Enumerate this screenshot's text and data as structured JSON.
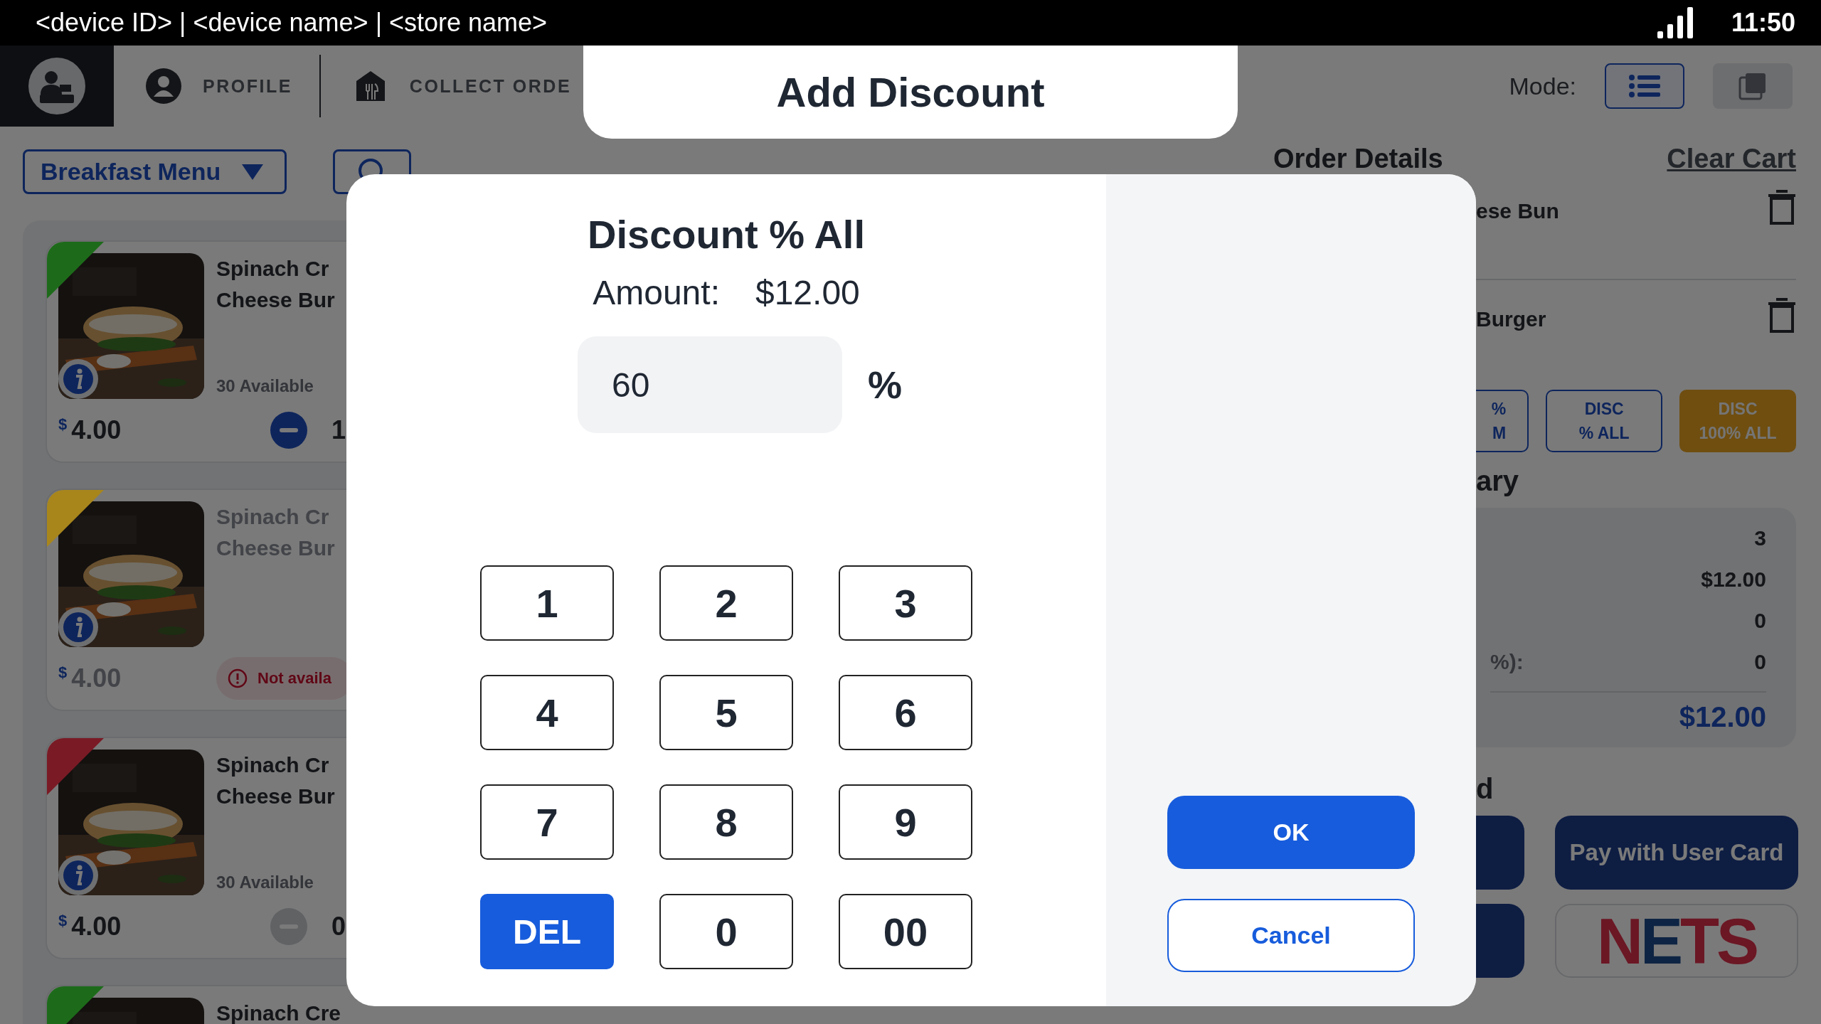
{
  "status_bar": {
    "device_info": "<device ID> | <device name> | <store name>",
    "time": "11:50"
  },
  "nav": {
    "tabs": [
      {
        "kind": "profile",
        "label": "PROFILE",
        "selected": false
      },
      {
        "kind": "store",
        "label": "COLLECT ORDE",
        "selected": false
      }
    ],
    "mode_label": "Mode:",
    "mode_options": [
      {
        "kind": "list",
        "selected": true
      },
      {
        "kind": "window",
        "selected": false
      }
    ]
  },
  "menu": {
    "category": "Breakfast Menu",
    "items": [
      {
        "color": "#1d6b1a",
        "name_lines": [
          "Spinach Cr",
          "Cheese Bur"
        ],
        "availability": "30 Available",
        "currency": "$",
        "price": "4.00",
        "kind": "stepper",
        "stepper_enabled": true,
        "qty": "1"
      },
      {
        "color": "#a8861c",
        "name_lines": [
          "Spinach Cr",
          "Cheese Bur"
        ],
        "currency": "$",
        "price": "4.00",
        "kind": "unavailable",
        "badge": "Not availa"
      },
      {
        "color": "#7a1a25",
        "name_lines": [
          "Spinach Cr",
          "Cheese Bur"
        ],
        "availability": "30 Available",
        "currency": "$",
        "price": "4.00",
        "kind": "stepper",
        "stepper_enabled": false,
        "qty": "0"
      },
      {
        "color": "#1d6b1a",
        "name_lines": [
          "Spinach Cre"
        ],
        "kind": "partial"
      }
    ]
  },
  "order": {
    "title": "Order Details",
    "clear": "Clear Cart",
    "lines": [
      "ese Bun",
      "Burger"
    ],
    "discount_buttons": [
      {
        "lines": [
          "%",
          "M"
        ],
        "selected": false
      },
      {
        "lines": [
          "DISC",
          "% ALL"
        ],
        "selected": false
      },
      {
        "lines": [
          "DISC",
          "100% ALL"
        ],
        "selected": true
      }
    ],
    "summary_heading": "ary",
    "summary_rows": [
      {
        "value": "3"
      },
      {
        "value": "$12.00"
      },
      {
        "value": "0"
      },
      {
        "label": "%):",
        "value": "0"
      }
    ],
    "total": "$12.00",
    "payment_heading": "d",
    "payments": [
      {
        "kind": "button"
      },
      {
        "kind": "button",
        "label": "Pay with User Card"
      },
      {
        "kind": "button"
      },
      {
        "kind": "nets",
        "label": "NETS"
      }
    ]
  },
  "modal": {
    "header": "Add Discount",
    "title": "Discount % All",
    "amount_label": "Amount:",
    "amount": "$12.00",
    "value": "60",
    "unit": "%",
    "keys": [
      {
        "kind": "digit",
        "label": "1"
      },
      {
        "kind": "digit",
        "label": "2"
      },
      {
        "kind": "digit",
        "label": "3"
      },
      {
        "kind": "digit",
        "label": "4"
      },
      {
        "kind": "digit",
        "label": "5"
      },
      {
        "kind": "digit",
        "label": "6"
      },
      {
        "kind": "digit",
        "label": "7"
      },
      {
        "kind": "digit",
        "label": "8"
      },
      {
        "kind": "digit",
        "label": "9"
      },
      {
        "kind": "delete",
        "label": "DEL"
      },
      {
        "kind": "digit",
        "label": "0"
      },
      {
        "kind": "digit",
        "label": "00"
      }
    ],
    "ok": "OK",
    "cancel": "Cancel"
  }
}
